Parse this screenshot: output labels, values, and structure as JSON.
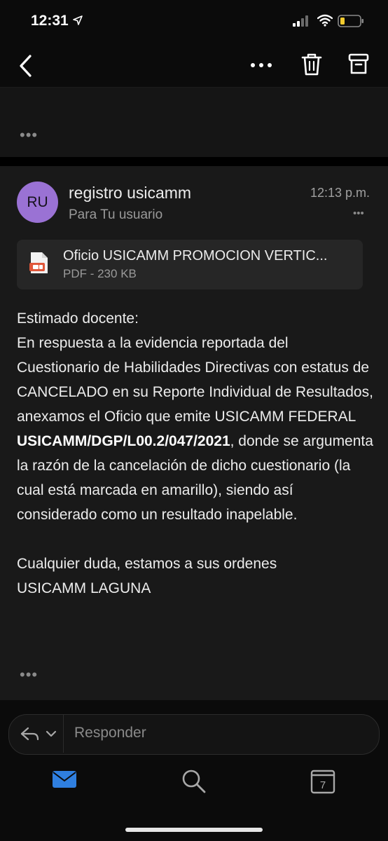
{
  "status": {
    "time": "12:31"
  },
  "thread": {
    "collapsed_more": "•••"
  },
  "email": {
    "avatar_initials": "RU",
    "sender": "registro usicamm",
    "recipient": "Para Tu usuario",
    "time": "12:13 p.m.",
    "header_more": "•••",
    "attachment": {
      "name": "Oficio USICAMM PROMOCION VERTIC...",
      "meta": "PDF - 230 KB"
    },
    "body": {
      "greeting": "Estimado docente:",
      "paragraph_start": "En respuesta a la evidencia reportada del Cuestionario de Habilidades Directivas con estatus de CANCELADO en su Reporte Individual de Resultados, anexamos el Oficio que emite USICAMM FEDERAL ",
      "reference": "USICAMM/DGP/L00.2/047/2021",
      "paragraph_end": ", donde se argumenta la razón de la cancelación de dicho cuestionario (la cual está marcada en amarillo), siendo así considerado como un resultado inapelable.",
      "closing": "Cualquier duda, estamos a sus ordenes",
      "signature": "USICAMM LAGUNA"
    },
    "body_more": "•••"
  },
  "reply": {
    "placeholder": "Responder"
  },
  "tabs": {
    "calendar_day": "7"
  },
  "colors": {
    "accent": "#2f7fe0",
    "avatar": "#9a72d4",
    "battery": "#f2cb2e"
  }
}
